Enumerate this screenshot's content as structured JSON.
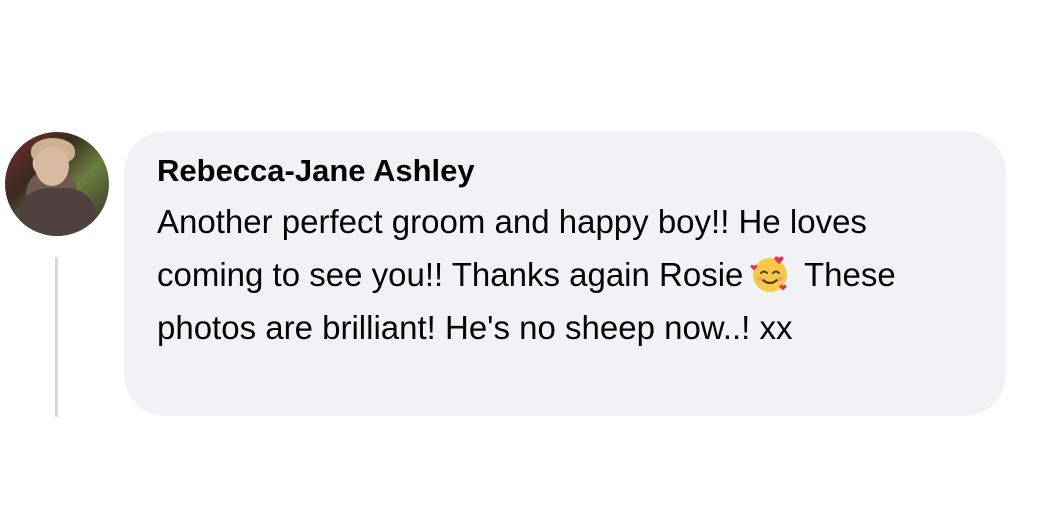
{
  "comment": {
    "author": "Rebecca-Jane Ashley",
    "text_part1": "Another perfect groom and happy boy!! He loves coming to see you!! Thanks again Rosie",
    "emoji": "smiling-face-with-hearts",
    "text_part2": "These photos are brilliant! He's no sheep now..! xx"
  },
  "colors": {
    "bubble_background": "#f0f2f5",
    "text": "#050505",
    "thread_line": "#d6d8dc"
  }
}
